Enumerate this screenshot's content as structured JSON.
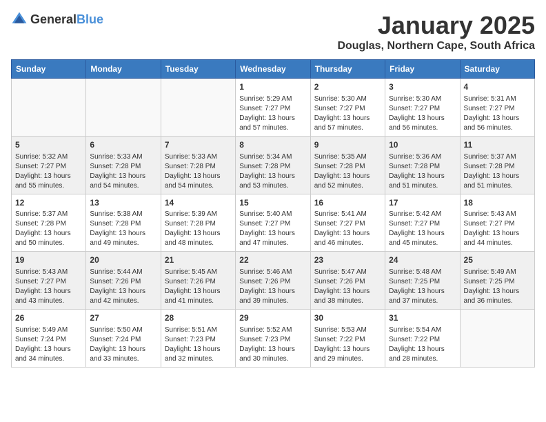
{
  "logo": {
    "general": "General",
    "blue": "Blue"
  },
  "header": {
    "month": "January 2025",
    "location": "Douglas, Northern Cape, South Africa"
  },
  "weekdays": [
    "Sunday",
    "Monday",
    "Tuesday",
    "Wednesday",
    "Thursday",
    "Friday",
    "Saturday"
  ],
  "weeks": [
    [
      {
        "day": "",
        "info": ""
      },
      {
        "day": "",
        "info": ""
      },
      {
        "day": "",
        "info": ""
      },
      {
        "day": "1",
        "info": "Sunrise: 5:29 AM\nSunset: 7:27 PM\nDaylight: 13 hours\nand 57 minutes."
      },
      {
        "day": "2",
        "info": "Sunrise: 5:30 AM\nSunset: 7:27 PM\nDaylight: 13 hours\nand 57 minutes."
      },
      {
        "day": "3",
        "info": "Sunrise: 5:30 AM\nSunset: 7:27 PM\nDaylight: 13 hours\nand 56 minutes."
      },
      {
        "day": "4",
        "info": "Sunrise: 5:31 AM\nSunset: 7:27 PM\nDaylight: 13 hours\nand 56 minutes."
      }
    ],
    [
      {
        "day": "5",
        "info": "Sunrise: 5:32 AM\nSunset: 7:27 PM\nDaylight: 13 hours\nand 55 minutes."
      },
      {
        "day": "6",
        "info": "Sunrise: 5:33 AM\nSunset: 7:28 PM\nDaylight: 13 hours\nand 54 minutes."
      },
      {
        "day": "7",
        "info": "Sunrise: 5:33 AM\nSunset: 7:28 PM\nDaylight: 13 hours\nand 54 minutes."
      },
      {
        "day": "8",
        "info": "Sunrise: 5:34 AM\nSunset: 7:28 PM\nDaylight: 13 hours\nand 53 minutes."
      },
      {
        "day": "9",
        "info": "Sunrise: 5:35 AM\nSunset: 7:28 PM\nDaylight: 13 hours\nand 52 minutes."
      },
      {
        "day": "10",
        "info": "Sunrise: 5:36 AM\nSunset: 7:28 PM\nDaylight: 13 hours\nand 51 minutes."
      },
      {
        "day": "11",
        "info": "Sunrise: 5:37 AM\nSunset: 7:28 PM\nDaylight: 13 hours\nand 51 minutes."
      }
    ],
    [
      {
        "day": "12",
        "info": "Sunrise: 5:37 AM\nSunset: 7:28 PM\nDaylight: 13 hours\nand 50 minutes."
      },
      {
        "day": "13",
        "info": "Sunrise: 5:38 AM\nSunset: 7:28 PM\nDaylight: 13 hours\nand 49 minutes."
      },
      {
        "day": "14",
        "info": "Sunrise: 5:39 AM\nSunset: 7:28 PM\nDaylight: 13 hours\nand 48 minutes."
      },
      {
        "day": "15",
        "info": "Sunrise: 5:40 AM\nSunset: 7:27 PM\nDaylight: 13 hours\nand 47 minutes."
      },
      {
        "day": "16",
        "info": "Sunrise: 5:41 AM\nSunset: 7:27 PM\nDaylight: 13 hours\nand 46 minutes."
      },
      {
        "day": "17",
        "info": "Sunrise: 5:42 AM\nSunset: 7:27 PM\nDaylight: 13 hours\nand 45 minutes."
      },
      {
        "day": "18",
        "info": "Sunrise: 5:43 AM\nSunset: 7:27 PM\nDaylight: 13 hours\nand 44 minutes."
      }
    ],
    [
      {
        "day": "19",
        "info": "Sunrise: 5:43 AM\nSunset: 7:27 PM\nDaylight: 13 hours\nand 43 minutes."
      },
      {
        "day": "20",
        "info": "Sunrise: 5:44 AM\nSunset: 7:26 PM\nDaylight: 13 hours\nand 42 minutes."
      },
      {
        "day": "21",
        "info": "Sunrise: 5:45 AM\nSunset: 7:26 PM\nDaylight: 13 hours\nand 41 minutes."
      },
      {
        "day": "22",
        "info": "Sunrise: 5:46 AM\nSunset: 7:26 PM\nDaylight: 13 hours\nand 39 minutes."
      },
      {
        "day": "23",
        "info": "Sunrise: 5:47 AM\nSunset: 7:26 PM\nDaylight: 13 hours\nand 38 minutes."
      },
      {
        "day": "24",
        "info": "Sunrise: 5:48 AM\nSunset: 7:25 PM\nDaylight: 13 hours\nand 37 minutes."
      },
      {
        "day": "25",
        "info": "Sunrise: 5:49 AM\nSunset: 7:25 PM\nDaylight: 13 hours\nand 36 minutes."
      }
    ],
    [
      {
        "day": "26",
        "info": "Sunrise: 5:49 AM\nSunset: 7:24 PM\nDaylight: 13 hours\nand 34 minutes."
      },
      {
        "day": "27",
        "info": "Sunrise: 5:50 AM\nSunset: 7:24 PM\nDaylight: 13 hours\nand 33 minutes."
      },
      {
        "day": "28",
        "info": "Sunrise: 5:51 AM\nSunset: 7:23 PM\nDaylight: 13 hours\nand 32 minutes."
      },
      {
        "day": "29",
        "info": "Sunrise: 5:52 AM\nSunset: 7:23 PM\nDaylight: 13 hours\nand 30 minutes."
      },
      {
        "day": "30",
        "info": "Sunrise: 5:53 AM\nSunset: 7:22 PM\nDaylight: 13 hours\nand 29 minutes."
      },
      {
        "day": "31",
        "info": "Sunrise: 5:54 AM\nSunset: 7:22 PM\nDaylight: 13 hours\nand 28 minutes."
      },
      {
        "day": "",
        "info": ""
      }
    ]
  ]
}
